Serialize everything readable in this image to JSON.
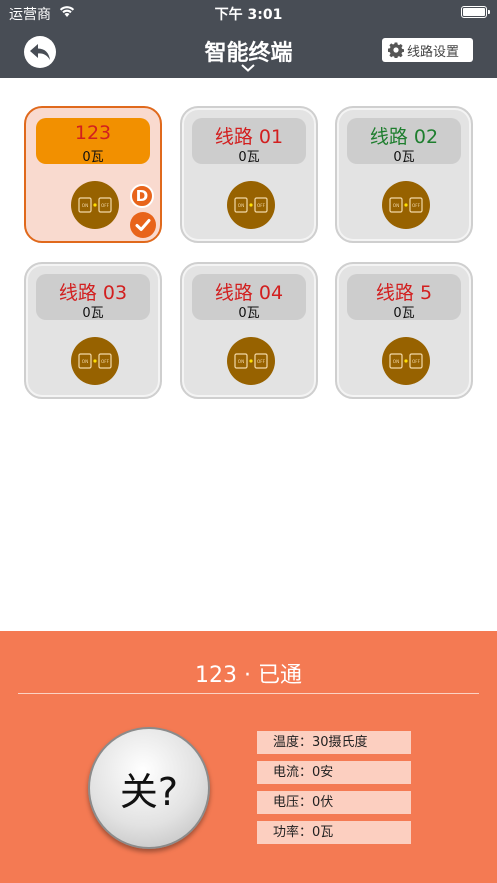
{
  "status_bar": {
    "carrier": "运营商",
    "time": "下午 3:01"
  },
  "nav": {
    "title": "智能终端",
    "settings_label": "线路设置"
  },
  "tiles": [
    {
      "name": "123",
      "watts": "0瓦",
      "active": true,
      "badge": "D"
    },
    {
      "name": "线路 01",
      "watts": "0瓦"
    },
    {
      "name": "线路 02",
      "watts": "0瓦",
      "name_color": "#1e7e2e"
    },
    {
      "name": "线路 03",
      "watts": "0瓦"
    },
    {
      "name": "线路 04",
      "watts": "0瓦"
    },
    {
      "name": "线路 5",
      "watts": "0瓦"
    }
  ],
  "switch_icon": {
    "on_label": "ON",
    "off_label": "OFF"
  },
  "panel": {
    "title": "123 · 已通",
    "power_label": "关?",
    "stats": [
      "温度：30摄氏度",
      "电流：0安",
      "电压：0伏",
      "功率：0瓦"
    ]
  },
  "colors": {
    "nav_bg": "#484d55",
    "panel_bg": "#f47a53",
    "active_head": "#f29000",
    "switch_bg": "#976200",
    "line_name_red": "#d21f1f"
  }
}
